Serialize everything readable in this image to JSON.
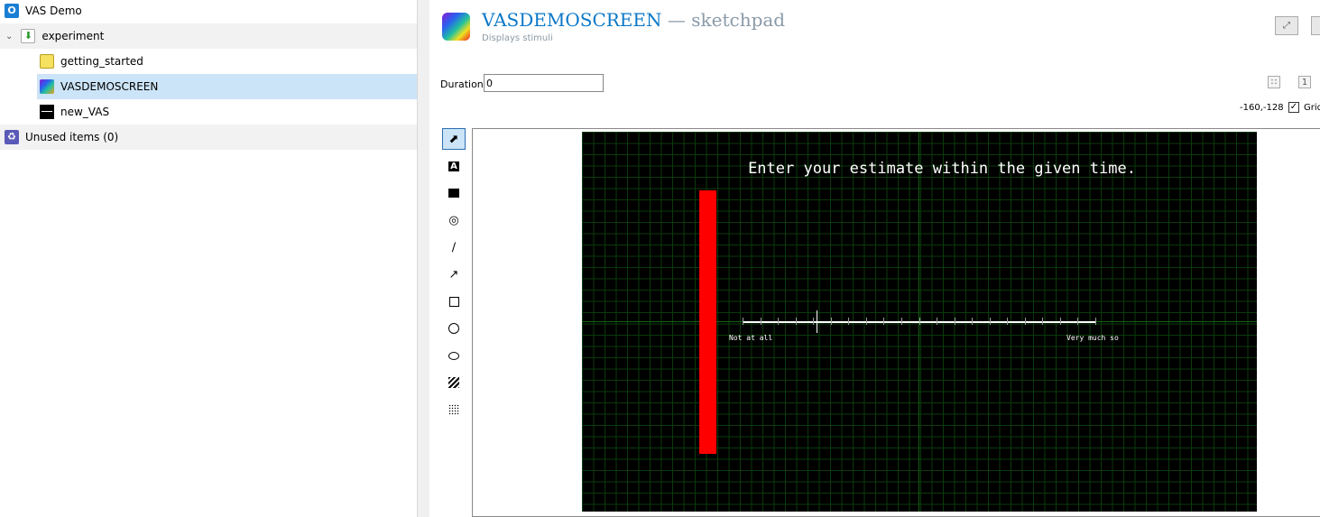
{
  "tree": {
    "root": "VAS Demo",
    "experiment": "experiment",
    "items": [
      "getting_started",
      "VASDEMOSCREEN",
      "new_VAS"
    ],
    "unused": "Unused items (0)"
  },
  "header": {
    "name": "VASDEMOSCREEN",
    "type": " — sketchpad",
    "description": "Displays stimuli"
  },
  "duration": {
    "label": "Duration",
    "value": "0"
  },
  "coords": "-160,-128",
  "grid": {
    "label": "Grid",
    "checked": true
  },
  "tools": [
    "select",
    "text",
    "image",
    "fixdot",
    "line",
    "arrow",
    "rectangle",
    "circle",
    "ellipse",
    "gabor",
    "noise"
  ],
  "sketchpad": {
    "text": "Enter your estimate within the given time.",
    "left_label": "Not at all",
    "right_label": "Very much so",
    "ticks": 21,
    "marker_tick": 4,
    "colors": {
      "background": "#000000",
      "grid": "#0b3a0b",
      "bar": "#ff0000",
      "line": "#ffffff"
    }
  }
}
